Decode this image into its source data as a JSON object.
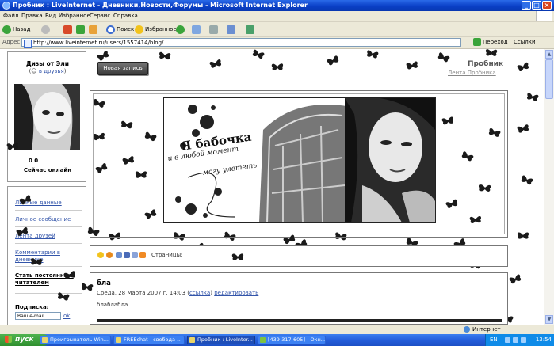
{
  "window": {
    "title": "Пробник : LiveInternet - Дневники,Новости,Форумы - Microsoft Internet Explorer",
    "minimize": "_",
    "maximize": "□",
    "close": "×"
  },
  "menu": [
    "Файл",
    "Правка",
    "Вид",
    "Избранное",
    "Сервис",
    "Справка"
  ],
  "toolbar": {
    "back": "Назад",
    "search": "Поиск",
    "favorites": "Избранное"
  },
  "address": {
    "label": "Адрес:",
    "url": "http://www.liveinternet.ru/users/1557414/blog/",
    "go": "Переход",
    "links": "Ссылки"
  },
  "page": {
    "user": {
      "name": "Дизы от Эли",
      "online_link": "в друзья",
      "counts": "0  0",
      "online": "Сейчас онлайн"
    },
    "nav": [
      "Личные данные",
      "Личное сообщение",
      "Лента друзей",
      "Комментарии в дневнике"
    ],
    "nav_bold": "Стать постоянным читателем",
    "subscribe": {
      "label": "Подписка:",
      "placeholder": "Ваш e-mail",
      "ok": "ok"
    },
    "new_post": "Новая запись",
    "blog_title": "Пробник",
    "blog_sub": "Лента Пробника",
    "banner": {
      "line1": "Я бабочка",
      "line2": "и в любой момент",
      "line3": "могу улететь"
    },
    "pages_label": "Страницы:",
    "post": {
      "title": "бла",
      "date": "Среда, 28 Марта 2007 г. 14:03 (",
      "link": "ссылка",
      "edit": "редактировать",
      "body": "блаблабла"
    }
  },
  "status": {
    "zone": "Интернет"
  },
  "taskbar": {
    "start": "пуск",
    "tasks": [
      "Проигрыватель Win...",
      "FREEchat - свобода ...",
      "Пробник : LiveInter...",
      "[439-317-605] - Окн..."
    ],
    "lang": "EN",
    "clock": "13:54"
  }
}
